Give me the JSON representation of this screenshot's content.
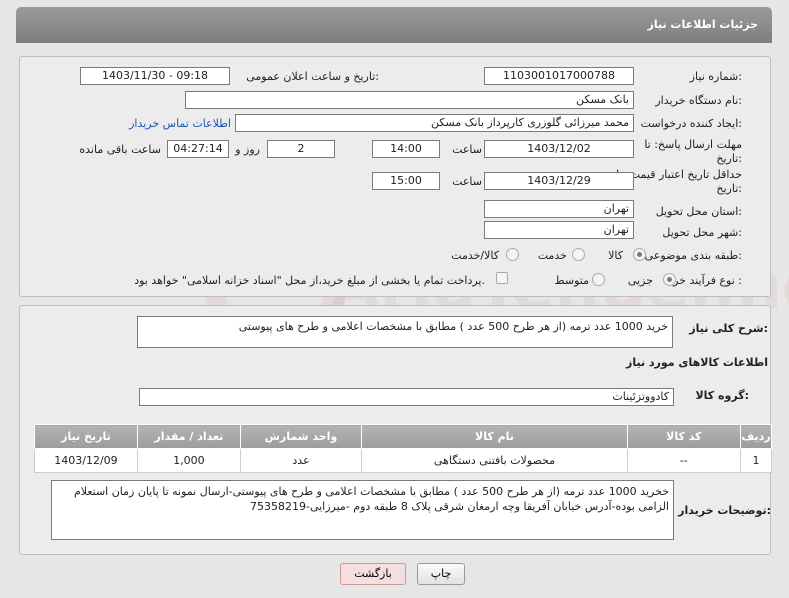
{
  "header": {
    "title": "جزئیات اطلاعات نیاز"
  },
  "form": {
    "need_number_label": "شماره نیاز:",
    "need_number": "1103001017000788",
    "announce_label": "تاریخ و ساعت اعلان عمومی:",
    "announce_value": "1403/11/30 - 09:18",
    "buyer_org_label": "نام دستگاه خریدار:",
    "buyer_org": "بانک مسکن",
    "creator_label": "ایجاد کننده درخواست:",
    "creator": "محمد میرزائی گلوزری کارپرداز بانک مسکن",
    "contact_link": "اطلاعات تماس خریدار",
    "deadline_label": "مهلت ارسال پاسخ: تا",
    "deadline_label2": "تاریخ:",
    "deadline_date": "1403/12/02",
    "time_label": "ساعت",
    "deadline_time": "14:00",
    "days_value": "2",
    "days_label": "روز و",
    "remaining_time": "04:27:14",
    "remaining_label": "ساعت باقی مانده",
    "validity_label": "حداقل تاریخ اعتبار قیمت: تا",
    "validity_label2": "تاریخ:",
    "validity_date": "1403/12/29",
    "validity_time_label": "ساعت",
    "validity_time": "15:00",
    "province_label": "استان محل تحویل:",
    "province": "تهران",
    "city_label": "شهر محل تحویل:",
    "city": "تهران",
    "category_label": "طبقه بندی موضوعی:",
    "category_options": [
      "کالا",
      "خدمت",
      "کالا/خدمت"
    ],
    "category_selected": "کالا",
    "process_label": "نوع فرآیند خرید :",
    "process_options": [
      "جزیی",
      "متوسط"
    ],
    "process_selected": "جزیی",
    "treasury_text": "پرداخت تمام یا بخشی از مبلغ خرید،از محل \"اسناد خزانه اسلامی\" خواهد بود."
  },
  "description": {
    "summary_label": "شرح کلی نیاز:",
    "summary": "خرید 1000 عدد ترمه (از هر طرح 500 عدد )  مطابق با مشخصات اعلامی و طرح های پیوستی",
    "goods_info_title": "اطلاعات کالاهای مورد نیاز",
    "group_label": "گروه کالا:",
    "group": "کادووتزئینات",
    "table": {
      "headers": [
        "ردیف",
        "کد کالا",
        "نام کالا",
        "واحد شمارش",
        "تعداد / مقدار",
        "تاریخ نیاز"
      ],
      "rows": [
        [
          "1",
          "--",
          "محصولات بافتنی دستگاهی",
          "عدد",
          "1,000",
          "1403/12/09"
        ]
      ]
    },
    "buyer_notes_label": "توضیحات خریدار:",
    "buyer_notes": "خخرید 1000 عدد ترمه (از هر طرح 500 عدد )  مطابق با مشخصات اعلامی و طرح های پیوستی-ارسال نمونه تا پایان زمان استعلام الزامی بوده-آدرس خیابان آفریقا وچه ارمغان شرقی پلاک 8 طبقه دوم -میرزایی-75358219"
  },
  "buttons": {
    "print": "چاپ",
    "back": "بازگشت"
  },
  "watermark": {
    "text": "AriaTender.neT"
  },
  "colors": {
    "header": "#8c8c8c",
    "link": "#1a56b0",
    "back_button": "#f7dede"
  }
}
